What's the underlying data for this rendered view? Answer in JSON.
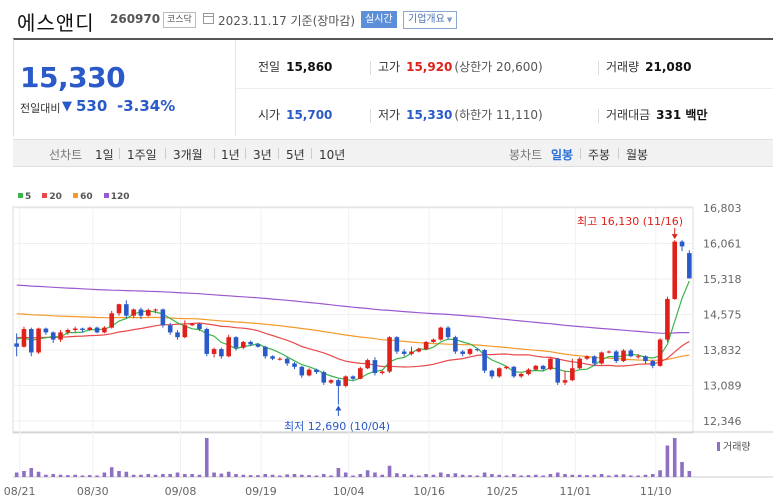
{
  "header": {
    "name": "에스앤디",
    "code": "260970",
    "market": "코스닥",
    "date": "2023.11.17 기준(장마감)",
    "realtime_label": "실시간",
    "overview_label": "기업개요"
  },
  "quote": {
    "price": "15,330",
    "change_label": "전일대비",
    "change_amount": "530",
    "change_rate": "-3.34%",
    "stats": {
      "prev": {
        "label": "전일",
        "value": "15,860"
      },
      "high": {
        "label": "고가",
        "value": "15,920",
        "sub": "(상한가 20,600)"
      },
      "volume": {
        "label": "거래량",
        "value": "21,080"
      },
      "open": {
        "label": "시가",
        "value": "15,700"
      },
      "low": {
        "label": "저가",
        "value": "15,330",
        "sub": "(하한가 11,110)"
      },
      "amount": {
        "label": "거래대금",
        "value": "331 백만"
      }
    }
  },
  "period_bar": {
    "line_label": "선차트",
    "line_periods": [
      "1일",
      "1주일",
      "3개월",
      "1년",
      "3년",
      "5년",
      "10년"
    ],
    "active_line_period": "3개월",
    "candle_label": "봉차트",
    "candle_periods": [
      "일봉",
      "주봉",
      "월봉"
    ],
    "active_candle_period": "일봉"
  },
  "colors": {
    "up": "#e0201b",
    "down": "#2a59c8",
    "ma5": "#3cb44b",
    "ma20": "#e84a4a",
    "ma60": "#f39a2b",
    "ma120": "#9b59d0",
    "volume": "#8f6fc4"
  },
  "chart_data": {
    "type": "candlestick",
    "legend": [
      {
        "name": "5",
        "color": "#3cb44b"
      },
      {
        "name": "20",
        "color": "#e84a4a"
      },
      {
        "name": "60",
        "color": "#f39a2b"
      },
      {
        "name": "120",
        "color": "#9b59d0"
      }
    ],
    "y_ticks": [
      "16,803",
      "16,061",
      "15,318",
      "14,575",
      "13,832",
      "13,089",
      "12,346"
    ],
    "ylim": [
      12346,
      16803
    ],
    "x_ticks": [
      "08/21",
      "08/30",
      "09/08",
      "09/19",
      "10/04",
      "10/16",
      "10/25",
      "11/01",
      "11/10"
    ],
    "high_annotation": "최고 16,130 (11/16)",
    "low_annotation": "최저 12,690 (10/04)",
    "volume_label": "거래량",
    "candles": [
      [
        13970,
        13900,
        14180,
        13700,
        60
      ],
      [
        13900,
        14270,
        14320,
        13880,
        80
      ],
      [
        14270,
        13780,
        14300,
        13700,
        120
      ],
      [
        13780,
        14280,
        14300,
        13750,
        70
      ],
      [
        14280,
        14200,
        14300,
        14150,
        30
      ],
      [
        14200,
        14050,
        14220,
        13980,
        40
      ],
      [
        14050,
        14200,
        14250,
        14000,
        30
      ],
      [
        14200,
        14250,
        14280,
        14150,
        25
      ],
      [
        14250,
        14280,
        14320,
        14200,
        30
      ],
      [
        14280,
        14250,
        14300,
        14200,
        20
      ],
      [
        14250,
        14300,
        14320,
        14230,
        25
      ],
      [
        14300,
        14200,
        14320,
        14180,
        20
      ],
      [
        14200,
        14300,
        14330,
        14180,
        60
      ],
      [
        14300,
        14600,
        14650,
        14280,
        130
      ],
      [
        14600,
        14790,
        14800,
        14550,
        80
      ],
      [
        14790,
        14550,
        14870,
        14500,
        70
      ],
      [
        14550,
        14680,
        14700,
        14500,
        30
      ],
      [
        14680,
        14550,
        14720,
        14480,
        30
      ],
      [
        14550,
        14670,
        14700,
        14530,
        40
      ],
      [
        14670,
        14680,
        14700,
        14600,
        30
      ],
      [
        14680,
        14350,
        14700,
        14300,
        40
      ],
      [
        14350,
        14200,
        14400,
        14150,
        40
      ],
      [
        14200,
        14100,
        14250,
        14050,
        60
      ],
      [
        14100,
        14350,
        14450,
        14080,
        40
      ],
      [
        14350,
        14380,
        14400,
        14330,
        40
      ],
      [
        14380,
        14270,
        14400,
        14230,
        30
      ],
      [
        14270,
        13750,
        14300,
        13700,
        520
      ],
      [
        13750,
        13850,
        13880,
        13680,
        60
      ],
      [
        13850,
        13700,
        13880,
        13650,
        45
      ],
      [
        13700,
        14100,
        14150,
        13680,
        70
      ],
      [
        14100,
        13880,
        14120,
        13820,
        40
      ],
      [
        13880,
        14000,
        14020,
        13850,
        30
      ],
      [
        14000,
        13950,
        14030,
        13920,
        25
      ],
      [
        13950,
        13900,
        13980,
        13880,
        25
      ],
      [
        13900,
        13700,
        13920,
        13650,
        40
      ],
      [
        13700,
        13650,
        13720,
        13620,
        30
      ],
      [
        13650,
        13650,
        13680,
        13610,
        20
      ],
      [
        13650,
        13550,
        13680,
        13500,
        35
      ],
      [
        13550,
        13480,
        13580,
        13430,
        40
      ],
      [
        13480,
        13300,
        13500,
        13250,
        30
      ],
      [
        13300,
        13420,
        13450,
        13280,
        25
      ],
      [
        13420,
        13370,
        13440,
        13330,
        20
      ],
      [
        13370,
        13150,
        13400,
        13100,
        40
      ],
      [
        13150,
        13200,
        13220,
        13120,
        20
      ],
      [
        13200,
        13080,
        13230,
        12690,
        120
      ],
      [
        13080,
        13280,
        13300,
        13050,
        60
      ],
      [
        13280,
        13230,
        13300,
        13200,
        20
      ],
      [
        13230,
        13450,
        13480,
        13220,
        40
      ],
      [
        13450,
        13620,
        13650,
        13430,
        90
      ],
      [
        13620,
        13350,
        13680,
        13300,
        60
      ],
      [
        13350,
        13380,
        13400,
        13320,
        30
      ],
      [
        13380,
        14100,
        14120,
        13350,
        150
      ],
      [
        14100,
        13800,
        14120,
        13750,
        50
      ],
      [
        13800,
        13750,
        13850,
        13700,
        40
      ],
      [
        13750,
        13800,
        13900,
        13720,
        30
      ],
      [
        13800,
        13850,
        13880,
        13780,
        20
      ],
      [
        13850,
        14000,
        14020,
        13830,
        40
      ],
      [
        14000,
        14050,
        14070,
        13980,
        30
      ],
      [
        14050,
        14300,
        14320,
        14030,
        60
      ],
      [
        14300,
        14100,
        14330,
        14050,
        40
      ],
      [
        14100,
        13800,
        14130,
        13750,
        50
      ],
      [
        13800,
        13750,
        13830,
        13700,
        30
      ],
      [
        13750,
        13850,
        13870,
        13720,
        25
      ],
      [
        13850,
        13830,
        13870,
        13800,
        20
      ],
      [
        13830,
        13400,
        13850,
        13350,
        60
      ],
      [
        13400,
        13280,
        13420,
        13230,
        40
      ],
      [
        13280,
        13450,
        13470,
        13250,
        30
      ],
      [
        13450,
        13480,
        13500,
        13430,
        20
      ],
      [
        13480,
        13280,
        13500,
        13250,
        40
      ],
      [
        13280,
        13330,
        13350,
        13250,
        20
      ],
      [
        13330,
        13420,
        13450,
        13300,
        25
      ],
      [
        13420,
        13500,
        13520,
        13400,
        30
      ],
      [
        13500,
        13430,
        13520,
        13400,
        20
      ],
      [
        13430,
        13650,
        13680,
        13410,
        40
      ],
      [
        13650,
        13150,
        13670,
        13100,
        60
      ],
      [
        13150,
        13200,
        13400,
        13100,
        40
      ],
      [
        13200,
        13450,
        13650,
        13180,
        30
      ],
      [
        13450,
        13650,
        13680,
        13430,
        30
      ],
      [
        13650,
        13700,
        13720,
        13620,
        25
      ],
      [
        13700,
        13550,
        13720,
        13500,
        30
      ],
      [
        13550,
        13780,
        13800,
        13530,
        40
      ],
      [
        13780,
        13800,
        13820,
        13760,
        20
      ],
      [
        13800,
        13600,
        13830,
        13560,
        30
      ],
      [
        13600,
        13820,
        13850,
        13580,
        35
      ],
      [
        13820,
        13700,
        13850,
        13680,
        20
      ],
      [
        13700,
        13700,
        13750,
        13650,
        20
      ],
      [
        13700,
        13600,
        13720,
        13550,
        30
      ],
      [
        13600,
        13500,
        13620,
        13450,
        40
      ],
      [
        13500,
        14050,
        14080,
        13480,
        90
      ],
      [
        14050,
        14900,
        14950,
        14000,
        420
      ],
      [
        14900,
        16100,
        16130,
        14880,
        520
      ],
      [
        16100,
        16000,
        16130,
        15900,
        200
      ],
      [
        15860,
        15330,
        15920,
        15330,
        80
      ]
    ]
  }
}
